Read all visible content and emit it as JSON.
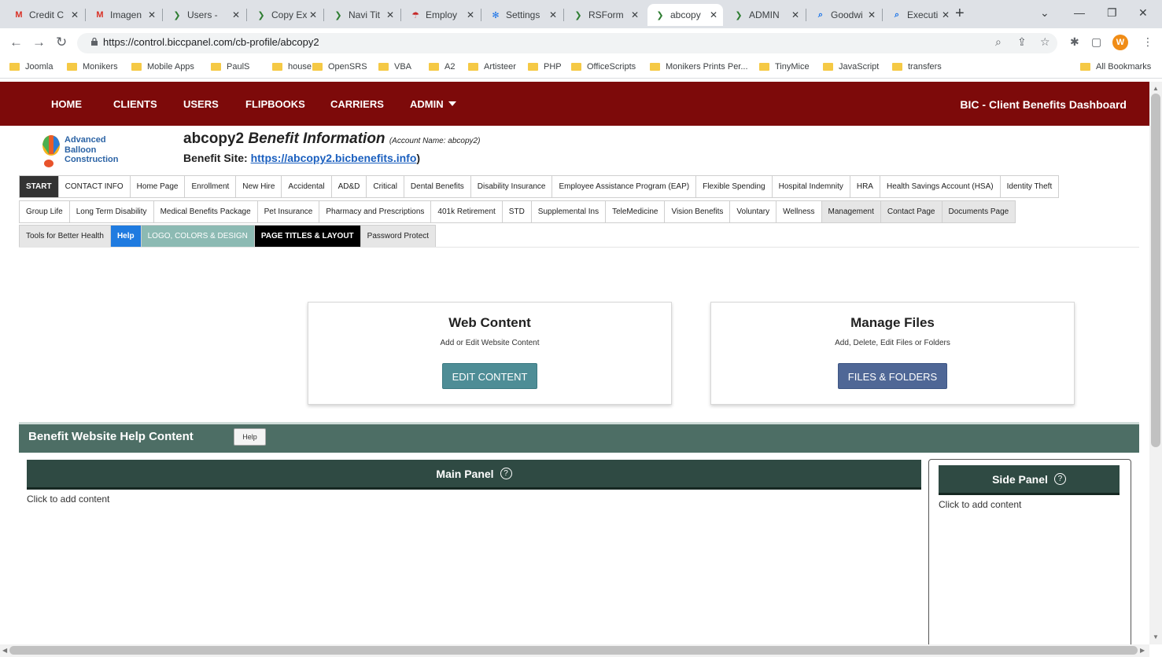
{
  "browser": {
    "tabs": [
      {
        "title": "Credit C",
        "icon": "gmail-icon"
      },
      {
        "title": "Imagen",
        "icon": "gmail-icon"
      },
      {
        "title": "Users -",
        "icon": "bic-icon"
      },
      {
        "title": "Copy Ex",
        "icon": "bic-icon"
      },
      {
        "title": "Navi Tit",
        "icon": "bic-icon"
      },
      {
        "title": "Employ",
        "icon": "umbrella-icon"
      },
      {
        "title": "Settings",
        "icon": "gear-icon"
      },
      {
        "title": "RSForm",
        "icon": "bic-icon"
      },
      {
        "title": "abcopy",
        "icon": "bic-icon"
      },
      {
        "title": "ADMIN",
        "icon": "bic-icon"
      },
      {
        "title": "Goodwi",
        "icon": "search-icon"
      },
      {
        "title": "Executi",
        "icon": "search-icon"
      }
    ],
    "active_tab": 8,
    "url": "https://control.biccpanel.com/cb-profile/abcopy2",
    "avatar_letter": "W",
    "bookmarks": [
      "Joomla",
      "Monikers",
      "Mobile Apps",
      "PaulS",
      "house",
      "OpenSRS",
      "VBA",
      "A2",
      "Artisteer",
      "PHP",
      "OfficeScripts",
      "Monikers Prints Per...",
      "TinyMice",
      "JavaScript",
      "transfers"
    ],
    "all_bookmarks": "All Bookmarks"
  },
  "nav": {
    "items": [
      "HOME",
      "CLIENTS",
      "USERS",
      "FLIPBOOKS",
      "CARRIERS",
      "ADMIN"
    ],
    "dashboard_title": "BIC - Client Benefits Dashboard",
    "bar_color": "#7d0a0a"
  },
  "logo": {
    "line1": "Advanced",
    "line2": "Balloon",
    "line3": "Construction"
  },
  "header": {
    "account": "abcopy2",
    "title": "Benefit Information",
    "account_note": "(Account Name: abcopy2)",
    "site_label": "Benefit Site:",
    "site_url": "https://abcopy2.bicbenefits.info",
    "site_close": ")"
  },
  "tabs": {
    "row1": [
      {
        "label": "START",
        "style": "start"
      },
      {
        "label": "CONTACT INFO",
        "style": "plain"
      },
      {
        "label": "Home Page",
        "style": "plain"
      },
      {
        "label": "Enrollment",
        "style": "plain"
      },
      {
        "label": "New Hire",
        "style": "plain"
      },
      {
        "label": "Accidental",
        "style": "plain"
      },
      {
        "label": "AD&D",
        "style": "plain"
      },
      {
        "label": "Critical",
        "style": "plain"
      },
      {
        "label": "Dental Benefits",
        "style": "plain"
      },
      {
        "label": "Disability Insurance",
        "style": "plain"
      },
      {
        "label": "Employee Assistance Program (EAP)",
        "style": "plain"
      },
      {
        "label": "Flexible Spending",
        "style": "plain"
      },
      {
        "label": "Hospital Indemnity",
        "style": "plain"
      },
      {
        "label": "HRA",
        "style": "plain"
      },
      {
        "label": "Health Savings Account (HSA)",
        "style": "plain"
      },
      {
        "label": "Identity Theft",
        "style": "plain"
      }
    ],
    "row2": [
      {
        "label": "Group Life",
        "style": "plain"
      },
      {
        "label": "Long Term Disability",
        "style": "plain"
      },
      {
        "label": "Medical Benefits Package",
        "style": "plain"
      },
      {
        "label": "Pet Insurance",
        "style": "plain"
      },
      {
        "label": "Pharmacy and Prescriptions",
        "style": "plain"
      },
      {
        "label": "401k Retirement",
        "style": "plain"
      },
      {
        "label": "STD",
        "style": "plain"
      },
      {
        "label": "Supplemental Ins",
        "style": "plain"
      },
      {
        "label": "TeleMedicine",
        "style": "plain"
      },
      {
        "label": "Vision Benefits",
        "style": "plain"
      },
      {
        "label": "Voluntary",
        "style": "plain"
      },
      {
        "label": "Wellness",
        "style": "plain"
      },
      {
        "label": "Management",
        "style": "gray"
      },
      {
        "label": "Contact Page",
        "style": "gray"
      },
      {
        "label": "Documents Page",
        "style": "gray"
      }
    ],
    "row3": [
      {
        "label": "Tools for Better Health",
        "style": "gray"
      },
      {
        "label": "Help",
        "style": "blue"
      },
      {
        "label": "LOGO, COLORS & DESIGN",
        "style": "teal"
      },
      {
        "label": "PAGE TITLES & LAYOUT",
        "style": "black"
      },
      {
        "label": "Password Protect",
        "style": "gray"
      }
    ]
  },
  "cards": {
    "web": {
      "title": "Web Content",
      "desc": "Add or Edit Website Content",
      "button": "EDIT CONTENT"
    },
    "files": {
      "title": "Manage Files",
      "desc": "Add, Delete, Edit Files or Folders",
      "button": "FILES & FOLDERS"
    }
  },
  "help": {
    "section_title": "Benefit Website Help Content",
    "help_button": "Help",
    "main_panel": "Main Panel",
    "side_panel": "Side Panel",
    "main_placeholder": "Click to add content",
    "side_placeholder": "Click to add content",
    "bar_color": "#4d6e65"
  }
}
